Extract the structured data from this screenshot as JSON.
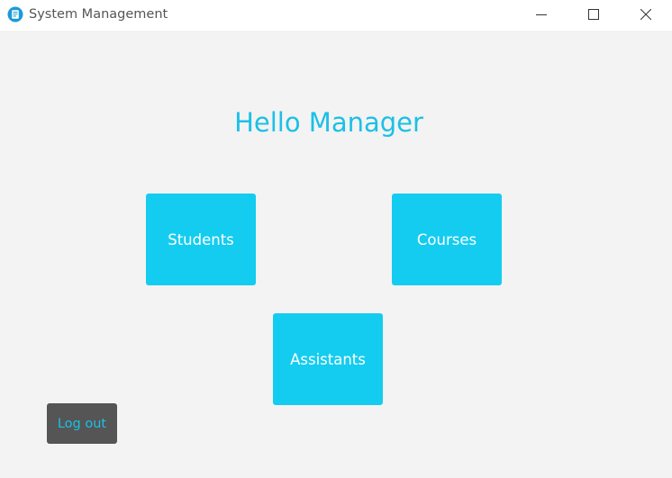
{
  "window": {
    "title": "System Management",
    "icon": "notepad-app-icon",
    "controls": [
      "minimize-icon",
      "maximize-icon",
      "close-icon"
    ]
  },
  "main": {
    "heading": "Hello Manager",
    "tiles": [
      {
        "label": "Students"
      },
      {
        "label": "Courses"
      },
      {
        "label": "Assistants"
      }
    ],
    "logout_label": "Log out"
  },
  "colors": {
    "accent": "#14ccf0",
    "heading": "#1bc0e6",
    "logout_bg": "#555555",
    "background": "#f3f3f3"
  }
}
